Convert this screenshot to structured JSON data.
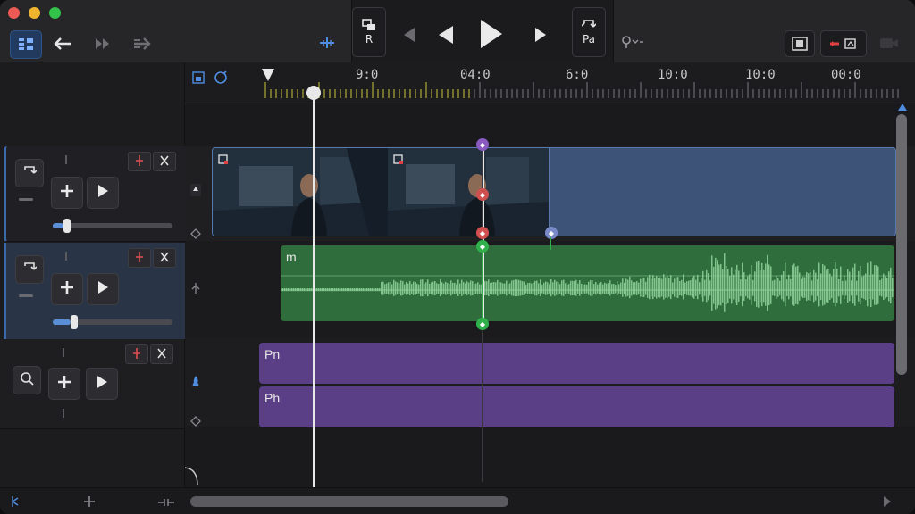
{
  "toolbar": {
    "left_buttons": [
      "timeline-view-icon",
      "back-arrow-icon",
      "forward-skip-icon",
      "forward-arrow-icon"
    ],
    "split_icon": "split-icon",
    "transport": {
      "left_stack_label": "R",
      "left_stack_icon": "clip-icon",
      "right_stack_label": "Pa",
      "right_stack_icon": "loop-icon"
    },
    "right_icon": "voice-menu-icon",
    "right_buttons": [
      "fullscreen-icon",
      "record-icon",
      "camera-icon"
    ]
  },
  "ruler": {
    "labels": [
      "9:0",
      "04:0",
      "6:0",
      "10:0",
      "10:0",
      "00:0"
    ]
  },
  "tracks": {
    "audio_clip_label": "m",
    "purple_clip_1_label": "Pn",
    "purple_clip_2_label": "Ph"
  },
  "sliders": {
    "track1_volume": 0.08,
    "track2_volume": 0.15
  },
  "colors": {
    "accent": "#3d6aa8",
    "video_clip": "#3d5378",
    "audio_clip": "#2f6e3c",
    "purple_clip": "#5a3f86",
    "playhead": "#e8e8e8"
  }
}
